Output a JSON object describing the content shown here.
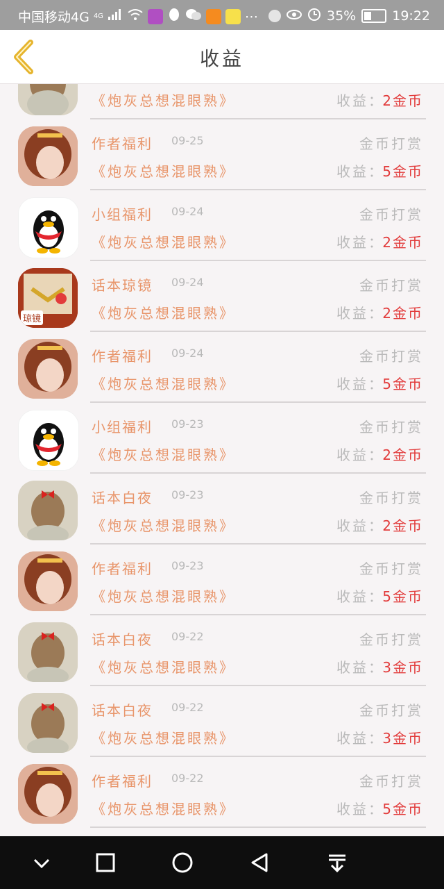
{
  "status_bar": {
    "carrier": "中国移动4G",
    "network_sup": "4G",
    "battery": "35%",
    "time": "19:22",
    "icons": [
      "signal-icon",
      "wifi-icon",
      "app-avatar-icon",
      "qq-icon",
      "wechat-icon",
      "video-app-icon",
      "news-app-icon",
      "more-icon",
      "nfc-icon",
      "eye-icon",
      "alarm-icon",
      "battery-icon"
    ]
  },
  "header": {
    "title": "收益",
    "back_icon": "chevron-left-icon"
  },
  "colors": {
    "accent_orange": "#e8956a",
    "value_red": "#e23b3b",
    "muted_gray": "#b9b9b9",
    "back_arrow": "#e6b42d"
  },
  "records": [
    {
      "avatar": "bow-girl",
      "source": "",
      "date": "",
      "type": "",
      "book": "《炮灰总想混眼熟》",
      "earning_label": "收益：",
      "earning_value": "2金币"
    },
    {
      "avatar": "anime-girl",
      "source": "作者福利",
      "date": "09-25",
      "type": "金币打赏",
      "book": "《炮灰总想混眼熟》",
      "earning_label": "收益：",
      "earning_value": "5金币"
    },
    {
      "avatar": "qq-penguin",
      "source": "小组福利",
      "date": "09-24",
      "type": "金币打赏",
      "book": "《炮灰总想混眼熟》",
      "earning_label": "收益：",
      "earning_value": "2金币"
    },
    {
      "avatar": "book-cover",
      "source": "话本琼镜",
      "date": "09-24",
      "type": "金币打赏",
      "book": "《炮灰总想混眼熟》",
      "earning_label": "收益：",
      "earning_value": "2金币"
    },
    {
      "avatar": "anime-girl",
      "source": "作者福利",
      "date": "09-24",
      "type": "金币打赏",
      "book": "《炮灰总想混眼熟》",
      "earning_label": "收益：",
      "earning_value": "5金币"
    },
    {
      "avatar": "qq-penguin",
      "source": "小组福利",
      "date": "09-23",
      "type": "金币打赏",
      "book": "《炮灰总想混眼熟》",
      "earning_label": "收益：",
      "earning_value": "2金币"
    },
    {
      "avatar": "bow-girl",
      "source": "话本白夜",
      "date": "09-23",
      "type": "金币打赏",
      "book": "《炮灰总想混眼熟》",
      "earning_label": "收益：",
      "earning_value": "2金币"
    },
    {
      "avatar": "anime-girl",
      "source": "作者福利",
      "date": "09-23",
      "type": "金币打赏",
      "book": "《炮灰总想混眼熟》",
      "earning_label": "收益：",
      "earning_value": "5金币"
    },
    {
      "avatar": "bow-girl",
      "source": "话本白夜",
      "date": "09-22",
      "type": "金币打赏",
      "book": "《炮灰总想混眼熟》",
      "earning_label": "收益：",
      "earning_value": "3金币"
    },
    {
      "avatar": "bow-girl",
      "source": "话本白夜",
      "date": "09-22",
      "type": "金币打赏",
      "book": "《炮灰总想混眼熟》",
      "earning_label": "收益：",
      "earning_value": "3金币"
    },
    {
      "avatar": "anime-girl",
      "source": "作者福利",
      "date": "09-22",
      "type": "金币打赏",
      "book": "《炮灰总想混眼熟》",
      "earning_label": "收益：",
      "earning_value": "5金币"
    }
  ],
  "book_cover_text": "琼镜",
  "nav_bar": {
    "buttons": [
      "collapse-down-icon",
      "recent-apps-icon",
      "home-icon",
      "back-icon",
      "notification-pull-icon"
    ]
  }
}
